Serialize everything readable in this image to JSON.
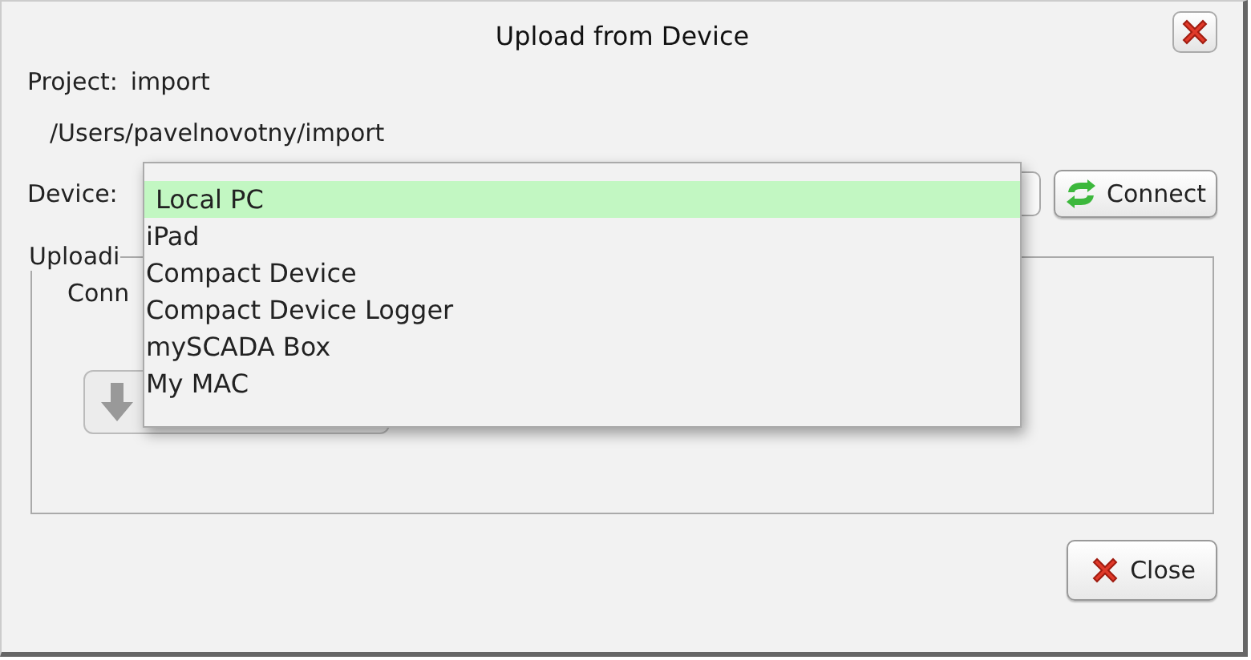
{
  "window": {
    "title": "Upload from Device"
  },
  "project": {
    "label": "Project:",
    "name": "import",
    "path": "/Users/pavelnovotny/import"
  },
  "device": {
    "label": "Device:",
    "options": [
      {
        "label": "Local PC",
        "selected": true
      },
      {
        "label": "iPad",
        "selected": false
      },
      {
        "label": "Compact Device",
        "selected": false
      },
      {
        "label": "Compact Device Logger",
        "selected": false
      },
      {
        "label": "mySCADA Box",
        "selected": false
      },
      {
        "label": "My MAC",
        "selected": false
      }
    ]
  },
  "connect_button": "Connect",
  "upload_group": {
    "title": "Uploadi",
    "status": "Conn",
    "upload_button": {
      "disabled": true
    }
  },
  "close_button": "Close"
}
